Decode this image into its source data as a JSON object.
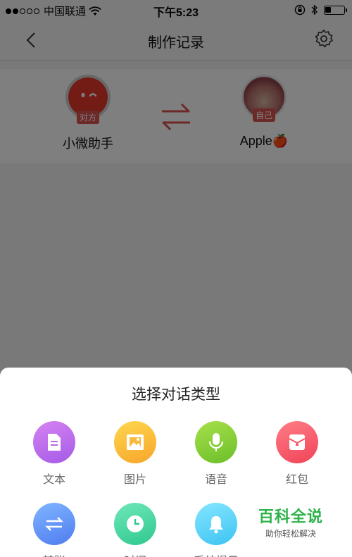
{
  "status_bar": {
    "carrier": "中国联通",
    "signal_dots_filled": 2,
    "signal_dots_total": 5,
    "time": "下午5:23",
    "battery_level": 0.35
  },
  "nav": {
    "title": "制作记录",
    "back_icon": "chevron-left-icon",
    "settings_icon": "gear-icon"
  },
  "parties": {
    "left": {
      "name": "小微助手",
      "role": "对方"
    },
    "right": {
      "name": "Apple🍎",
      "role": "自己"
    },
    "swap_icon": "swap-arrows-icon",
    "accent": "#d9534f"
  },
  "sheet": {
    "title": "选择对话类型",
    "options": [
      {
        "label": "文本",
        "icon": "document-icon"
      },
      {
        "label": "图片",
        "icon": "image-icon"
      },
      {
        "label": "语音",
        "icon": "microphone-icon"
      },
      {
        "label": "红包",
        "icon": "red-packet-icon"
      },
      {
        "label": "转账",
        "icon": "transfer-icon"
      },
      {
        "label": "时间",
        "icon": "clock-icon"
      },
      {
        "label": "系统提示",
        "icon": "bell-icon"
      }
    ]
  },
  "watermark": {
    "main": "百科全说",
    "sub": "助你轻松解决"
  }
}
